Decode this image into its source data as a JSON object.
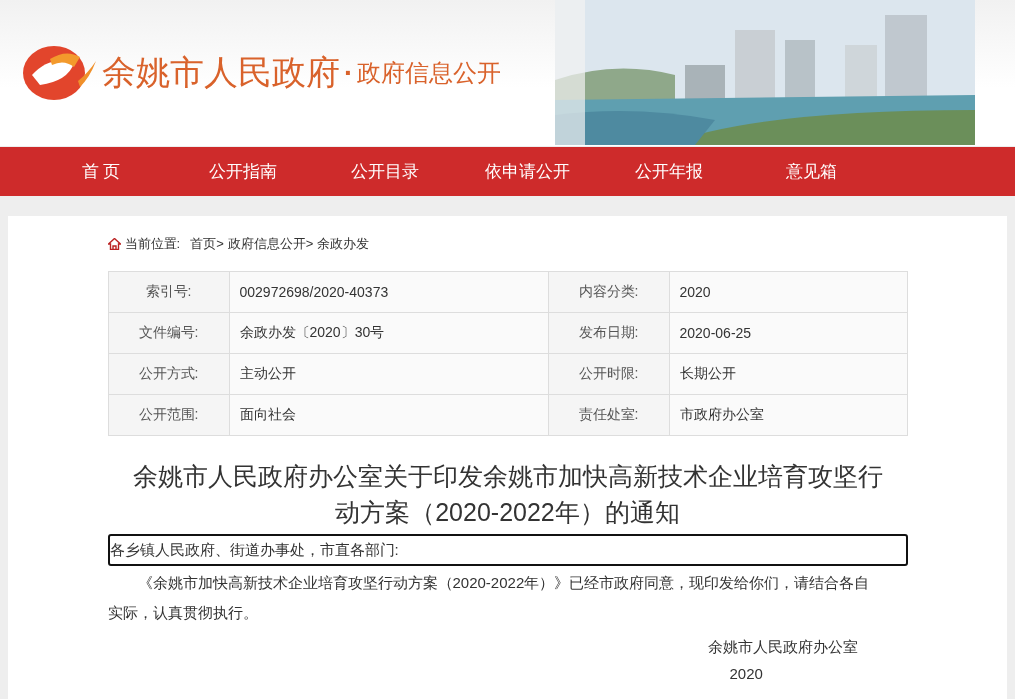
{
  "header": {
    "site_name": "余姚市人民政府",
    "separator": "·",
    "section": "政府信息公开"
  },
  "nav": [
    {
      "label": "首 页",
      "selected": false
    },
    {
      "label": "公开指南",
      "selected": false
    },
    {
      "label": "公开目录",
      "selected": false
    },
    {
      "label": "依申请公开",
      "selected": false
    },
    {
      "label": "公开年报",
      "selected": false
    },
    {
      "label": "意见箱",
      "selected": false
    }
  ],
  "breadcrumb": {
    "label": "当前位置:",
    "items": [
      "首页>",
      "政府信息公开>",
      "余政办发"
    ]
  },
  "meta_table": [
    [
      {
        "label": "索引号:",
        "value": "002972698/2020-40373"
      },
      {
        "label": "内容分类:",
        "value": "2020"
      }
    ],
    [
      {
        "label": "文件编号:",
        "value": "余政办发〔2020〕30号"
      },
      {
        "label": "发布日期:",
        "value": "2020-06-25"
      }
    ],
    [
      {
        "label": "公开方式:",
        "value": "主动公开"
      },
      {
        "label": "公开时限:",
        "value": "长期公开"
      }
    ],
    [
      {
        "label": "公开范围:",
        "value": "面向社会"
      },
      {
        "label": "责任处室:",
        "value": "市政府办公室"
      }
    ]
  ],
  "article": {
    "title": "余姚市人民政府办公室关于印发余姚市加快高新技术企业培育攻坚行动方案（2020-2022年）的通知",
    "salutation": "各乡镇人民政府、街道办事处，市直各部门:",
    "paragraphs": [
      "《余姚市加快高新技术企业培育攻坚行动方案（2020-2022年）》已经市政府同意，现印发给你们，请结合各自实际，认真贯彻执行。"
    ],
    "signature": "余姚市人民政府办公室",
    "date": "2020"
  }
}
